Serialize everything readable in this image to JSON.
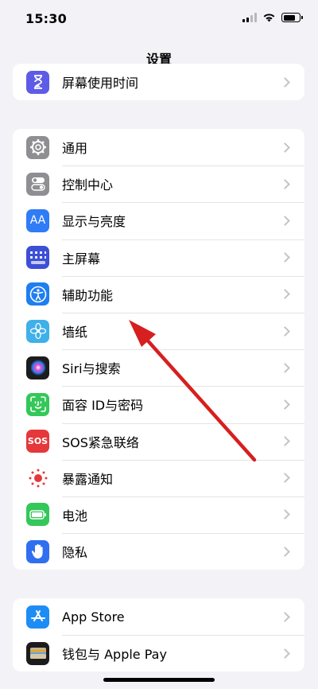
{
  "status": {
    "time": "15:30"
  },
  "nav": {
    "title": "设置"
  },
  "group_top": {
    "items": [
      {
        "label": "屏幕使用时间",
        "icon": "hourglass-icon",
        "color": "#5e5ce6"
      }
    ]
  },
  "group_main": {
    "items": [
      {
        "label": "通用",
        "icon": "gear-icon",
        "color": "#8e8e93"
      },
      {
        "label": "控制中心",
        "icon": "toggles-icon",
        "color": "#8e8e93"
      },
      {
        "label": "显示与亮度",
        "icon": "aa-icon",
        "glyph": "AA",
        "color": "#2f7cf6"
      },
      {
        "label": "主屏幕",
        "icon": "home-grid-icon",
        "color": "#3c4fd6"
      },
      {
        "label": "辅助功能",
        "icon": "accessibility-icon",
        "color": "#1f7ef0"
      },
      {
        "label": "墙纸",
        "icon": "wallpaper-flower-icon",
        "color": "#3fb0e8"
      },
      {
        "label": "Siri与搜索",
        "icon": "siri-icon",
        "color": "#1c1c1e"
      },
      {
        "label": "面容 ID与密码",
        "icon": "face-id-icon",
        "color": "#34c759"
      },
      {
        "label": "SOS紧急联络",
        "icon": "sos-icon",
        "glyph": "SOS",
        "color": "#e5383b"
      },
      {
        "label": "暴露通知",
        "icon": "exposure-icon",
        "color": "#ffffff"
      },
      {
        "label": "电池",
        "icon": "battery-icon",
        "color": "#34c759"
      },
      {
        "label": "隐私",
        "icon": "hand-icon",
        "color": "#2f6ff0"
      }
    ]
  },
  "group_bottom": {
    "items": [
      {
        "label": "App Store",
        "icon": "app-store-icon",
        "color": "#1e8cf5"
      },
      {
        "label": "钱包与 Apple Pay",
        "icon": "wallet-icon",
        "color": "#1c1c1e"
      }
    ]
  },
  "annotation": {
    "arrow_color": "#d61f1f",
    "arrow_target": "墙纸"
  }
}
